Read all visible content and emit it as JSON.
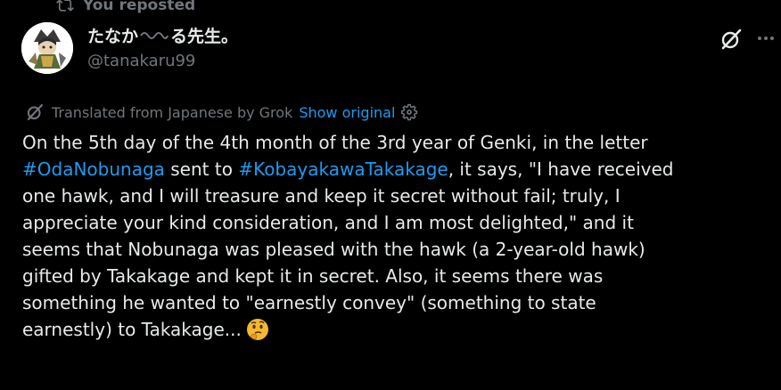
{
  "repost": {
    "icon": "repost-icon",
    "label": "You reposted"
  },
  "author": {
    "avatar": "avatar-illustration",
    "display_name_part1": "たなか",
    "display_name_part2": "る先生。",
    "handle": "@tanakaru99"
  },
  "actions": {
    "grok_icon": "grok-icon",
    "more_icon": "more-icon"
  },
  "translation": {
    "icon": "grok-icon",
    "label": "Translated from Japanese by Grok",
    "show_original": "Show original",
    "settings_icon": "gear-icon"
  },
  "tweet": {
    "l1": "On the 5th day of the 4th month of the 3rd year of Genki, in the letter",
    "hashtag1": "#OdaNobunaga",
    "l2_mid": " sent to ",
    "hashtag2": "#KobayakawaTakakage",
    "l2_end": ", it says, \"I have received",
    "l3": "one hawk, and I will treasure and keep it secret without fail; truly, I",
    "l4": "appreciate your kind consideration, and I am most delighted,\" and it",
    "l5": "seems that Nobunaga was pleased with the hawk (a 2-year-old hawk)",
    "l6": "gifted by Takakage and kept it in secret. Also, it seems there was",
    "l7": "something he wanted to \"earnestly convey\" (something to state",
    "l8": "earnestly) to Takakage...",
    "emoji": "thinking-face-emoji"
  },
  "colors": {
    "background": "#000000",
    "text": "#e7e9ea",
    "secondary": "#71767b",
    "accent": "#1d9bf0"
  }
}
